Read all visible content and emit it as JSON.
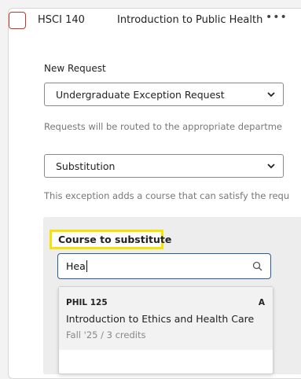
{
  "course_header": {
    "code": "HSCI 140",
    "name": "Introduction to Public Health",
    "more_icon": "more-icon",
    "checkbox_color": "#c0392b"
  },
  "request": {
    "label": "New Request",
    "type_value": "Undergraduate Exception Request",
    "routing_note": "Requests will be routed to the appropriate departme",
    "exception_value": "Substitution",
    "exception_note": "This exception adds a course that can satisfy the requ"
  },
  "substitute": {
    "label": "Course to substitute",
    "search_value": "Hea",
    "highlight_color": "#f4e400",
    "focus_color": "#2b5d95"
  },
  "results": [
    {
      "code": "PHIL 125",
      "grade": "A",
      "title": "Introduction to Ethics and Health Care",
      "meta": "Fall '25 / 3 credits"
    }
  ]
}
